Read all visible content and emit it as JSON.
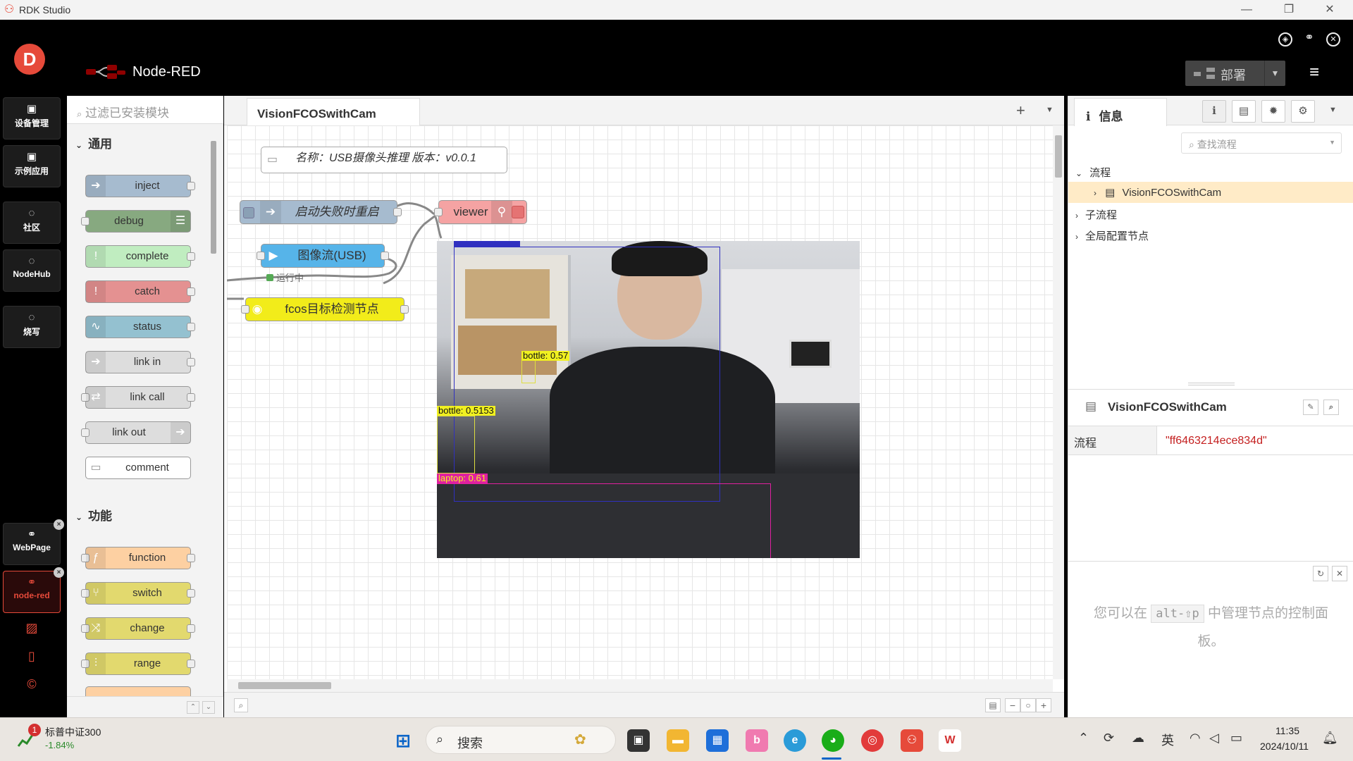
{
  "window": {
    "title": "RDK Studio",
    "minimize": "—",
    "maximize": "❐",
    "close": "✕"
  },
  "leftbar": {
    "logo": "D",
    "items": [
      {
        "label": "设备管理"
      },
      {
        "label": "示例应用"
      },
      {
        "label": "社区"
      },
      {
        "label": "NodeHub"
      },
      {
        "label": "烧写"
      },
      {
        "label": "WebPage"
      },
      {
        "label": "node-red"
      }
    ],
    "close_glyph": "×"
  },
  "topbar": {
    "app_title": "Node-RED",
    "deploy_label": "部署",
    "deploy_arrow": "▼",
    "menu_glyph": "≡"
  },
  "palette": {
    "search_placeholder": "过滤已安装模块",
    "category_common": "通用",
    "category_function": "功能",
    "common_nodes": [
      {
        "label": "inject",
        "color": "#a6bbcf"
      },
      {
        "label": "debug",
        "color": "#87a980"
      },
      {
        "label": "complete",
        "color": "#c0edc0"
      },
      {
        "label": "catch",
        "color": "#e49191"
      },
      {
        "label": "status",
        "color": "#94c1d0"
      },
      {
        "label": "link in",
        "color": "#dddddd"
      },
      {
        "label": "link call",
        "color": "#dddddd"
      },
      {
        "label": "link out",
        "color": "#dddddd"
      },
      {
        "label": "comment",
        "color": "#ffffff"
      }
    ],
    "function_nodes": [
      {
        "label": "function",
        "color": "#fdd0a2"
      },
      {
        "label": "switch",
        "color": "#e2d96e"
      },
      {
        "label": "change",
        "color": "#e2d96e"
      },
      {
        "label": "range",
        "color": "#e2d96e"
      }
    ]
  },
  "workspace": {
    "tab": "VisionFCOSwithCam",
    "add_glyph": "+",
    "dropdown_glyph": "▼",
    "comment": "名称：USB摄像头推理 版本：v0.0.1",
    "nodes": {
      "restart": "启动失败时重启",
      "viewer": "viewer",
      "camera": "图像流(USB)",
      "camera_status": "运行中",
      "fcos": "fcos目标检测节点"
    },
    "detections": [
      {
        "label": "bottle: 0.57"
      },
      {
        "label": "bottle: 0.5153"
      },
      {
        "label": "laptop: 0.61"
      }
    ]
  },
  "sidebar": {
    "tab_info": "信息",
    "search_placeholder": "查找流程",
    "tree": {
      "flows": "流程",
      "flow_item": "VisionFCOSwithCam",
      "subflows": "子流程",
      "global_config": "全局配置节点"
    },
    "info_title": "VisionFCOSwithCam",
    "prop_key": "流程",
    "prop_value": "\"ff6463214ece834d\"",
    "help_prefix": "您可以在",
    "help_key": "alt-⇧p",
    "help_suffix": "中管理节点的控制面板。"
  },
  "taskbar": {
    "stock_name": "标普中证300",
    "stock_change": "-1.84%",
    "stock_badge": "1",
    "search_label": "搜索",
    "ime": "英",
    "time": "11:35",
    "date": "2024/10/11"
  }
}
